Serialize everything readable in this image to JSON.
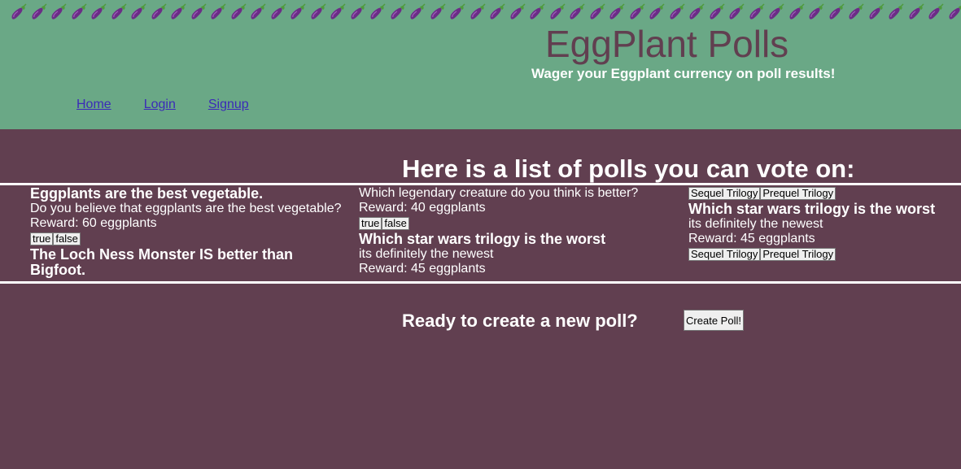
{
  "header": {
    "emoji_icon": "eggplant-icon",
    "emoji_count": 48,
    "title": "EggPlant Polls",
    "tagline": "Wager your Eggplant currency on poll results!",
    "colors": {
      "header_bg": "#6aa886",
      "page_bg": "#613f50",
      "title": "#613f50",
      "link": "#3b2bb8"
    }
  },
  "nav": {
    "items": [
      {
        "label": "Home"
      },
      {
        "label": "Login"
      },
      {
        "label": "Signup"
      }
    ]
  },
  "polls": {
    "heading": "Here is a list of polls you can vote on:",
    "col1": {
      "poll1": {
        "title": "Eggplants are the best vegetable.",
        "description": "Do you believe that eggplants are the best vegetable?",
        "reward": "Reward: 60 eggplants",
        "options": [
          "true",
          "false"
        ]
      },
      "poll2": {
        "title": "The Loch Ness Monster IS better than Bigfoot."
      }
    },
    "col2": {
      "poll2_cont": {
        "description": "Which legendary creature do you think is better?",
        "reward": "Reward: 40 eggplants",
        "options": [
          "true",
          "false"
        ]
      },
      "poll3": {
        "title": "Which star wars trilogy is the worst",
        "description": "its definitely the newest",
        "reward": "Reward: 45 eggplants"
      }
    },
    "col3": {
      "poll3_options": [
        "Sequel Trilogy",
        "Prequel Trilogy"
      ],
      "poll4": {
        "title": "Which star wars trilogy is the worst",
        "description": "its definitely the newest",
        "reward": "Reward: 45 eggplants",
        "options": [
          "Sequel Trilogy",
          "Prequel Trilogy"
        ]
      }
    }
  },
  "create": {
    "prompt": "Ready to create a new poll?",
    "button_label": "Create Poll!"
  }
}
